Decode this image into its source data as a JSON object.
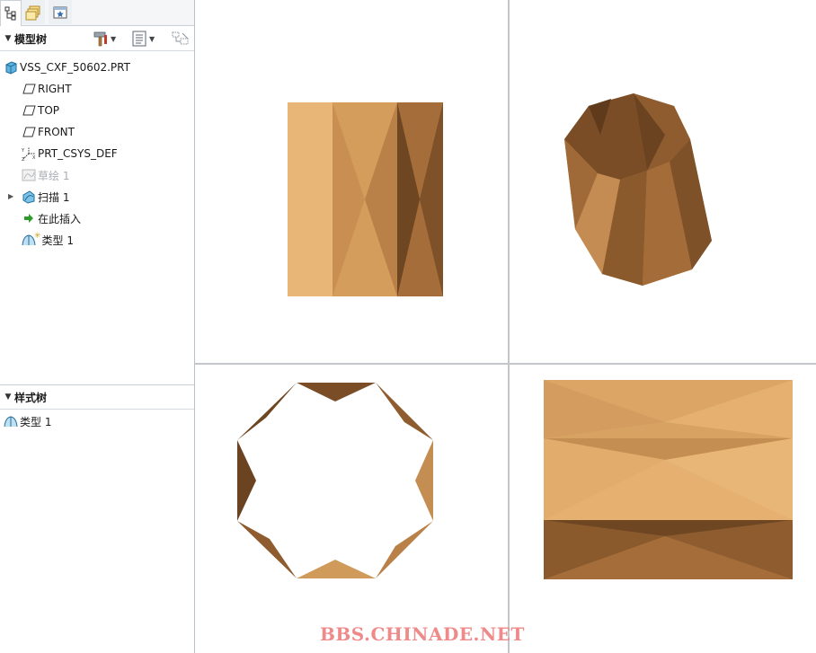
{
  "model_tree": {
    "title": "模型树",
    "items": [
      {
        "label": "VSS_CXF_50602.PRT",
        "icon": "part-icon"
      },
      {
        "label": "RIGHT",
        "icon": "datum-plane-icon"
      },
      {
        "label": "TOP",
        "icon": "datum-plane-icon"
      },
      {
        "label": "FRONT",
        "icon": "datum-plane-icon"
      },
      {
        "label": "PRT_CSYS_DEF",
        "icon": "coordinate-system-icon"
      },
      {
        "label": "草绘 1",
        "icon": "sketch-icon"
      },
      {
        "label": "扫描 1",
        "icon": "sweep-icon"
      },
      {
        "label": "在此插入",
        "icon": "insert-here-arrow-icon"
      },
      {
        "label": "类型 1",
        "icon": "style-surface-icon"
      }
    ]
  },
  "style_tree": {
    "title": "样式树",
    "items": [
      {
        "label": "类型 1",
        "icon": "style-surface-icon"
      }
    ]
  },
  "watermark": "BBS.CHINADE.NET",
  "colors": {
    "wood_light": "#e3ad6c",
    "wood_mid": "#c48d52",
    "wood_dark": "#8a5a2c",
    "wood_darkest": "#6b4320",
    "divider": "#c3c7cc",
    "watermark": "#ef8a8a"
  }
}
